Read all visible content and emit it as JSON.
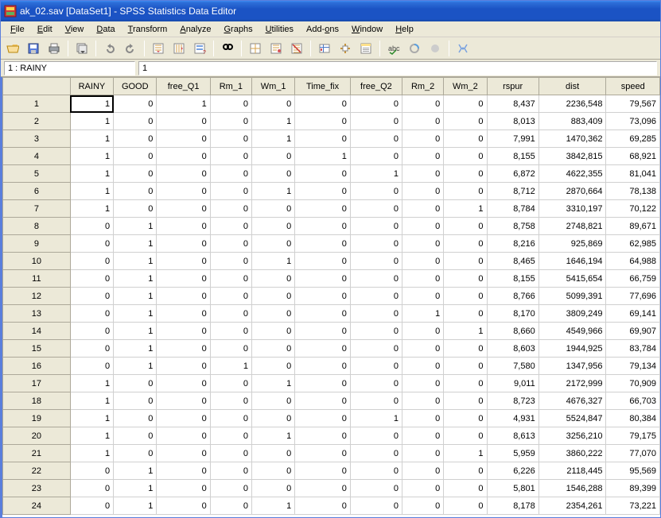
{
  "window": {
    "title": "ak_02.sav [DataSet1] - SPSS Statistics Data Editor"
  },
  "menu": {
    "file": "File",
    "edit": "Edit",
    "view": "View",
    "data": "Data",
    "transform": "Transform",
    "analyze": "Analyze",
    "graphs": "Graphs",
    "utilities": "Utilities",
    "addons": "Add-ons",
    "window": "Window",
    "help": "Help"
  },
  "subbar": {
    "label": "1 : RAINY",
    "value": "1"
  },
  "columns": [
    "RAINY",
    "GOOD",
    "free_Q1",
    "Rm_1",
    "Wm_1",
    "Time_fix",
    "free_Q2",
    "Rm_2",
    "Wm_2",
    "rspur",
    "dist",
    "speed"
  ],
  "rows": [
    [
      1,
      0,
      1,
      0,
      0,
      0,
      0,
      0,
      0,
      "8,437",
      "2236,548",
      "79,567"
    ],
    [
      1,
      0,
      0,
      0,
      1,
      0,
      0,
      0,
      0,
      "8,013",
      "883,409",
      "73,096"
    ],
    [
      1,
      0,
      0,
      0,
      1,
      0,
      0,
      0,
      0,
      "7,991",
      "1470,362",
      "69,285"
    ],
    [
      1,
      0,
      0,
      0,
      0,
      1,
      0,
      0,
      0,
      "8,155",
      "3842,815",
      "68,921"
    ],
    [
      1,
      0,
      0,
      0,
      0,
      0,
      1,
      0,
      0,
      "6,872",
      "4622,355",
      "81,041"
    ],
    [
      1,
      0,
      0,
      0,
      1,
      0,
      0,
      0,
      0,
      "8,712",
      "2870,664",
      "78,138"
    ],
    [
      1,
      0,
      0,
      0,
      0,
      0,
      0,
      0,
      1,
      "8,784",
      "3310,197",
      "70,122"
    ],
    [
      0,
      1,
      0,
      0,
      0,
      0,
      0,
      0,
      0,
      "8,758",
      "2748,821",
      "89,671"
    ],
    [
      0,
      1,
      0,
      0,
      0,
      0,
      0,
      0,
      0,
      "8,216",
      "925,869",
      "62,985"
    ],
    [
      0,
      1,
      0,
      0,
      1,
      0,
      0,
      0,
      0,
      "8,465",
      "1646,194",
      "64,988"
    ],
    [
      0,
      1,
      0,
      0,
      0,
      0,
      0,
      0,
      0,
      "8,155",
      "5415,654",
      "66,759"
    ],
    [
      0,
      1,
      0,
      0,
      0,
      0,
      0,
      0,
      0,
      "8,766",
      "5099,391",
      "77,696"
    ],
    [
      0,
      1,
      0,
      0,
      0,
      0,
      0,
      1,
      0,
      "8,170",
      "3809,249",
      "69,141"
    ],
    [
      0,
      1,
      0,
      0,
      0,
      0,
      0,
      0,
      1,
      "8,660",
      "4549,966",
      "69,907"
    ],
    [
      0,
      1,
      0,
      0,
      0,
      0,
      0,
      0,
      0,
      "8,603",
      "1944,925",
      "83,784"
    ],
    [
      0,
      1,
      0,
      1,
      0,
      0,
      0,
      0,
      0,
      "7,580",
      "1347,956",
      "79,134"
    ],
    [
      1,
      0,
      0,
      0,
      1,
      0,
      0,
      0,
      0,
      "9,011",
      "2172,999",
      "70,909"
    ],
    [
      1,
      0,
      0,
      0,
      0,
      0,
      0,
      0,
      0,
      "8,723",
      "4676,327",
      "66,703"
    ],
    [
      1,
      0,
      0,
      0,
      0,
      0,
      1,
      0,
      0,
      "4,931",
      "5524,847",
      "80,384"
    ],
    [
      1,
      0,
      0,
      0,
      1,
      0,
      0,
      0,
      0,
      "8,613",
      "3256,210",
      "79,175"
    ],
    [
      1,
      0,
      0,
      0,
      0,
      0,
      0,
      0,
      1,
      "5,959",
      "3860,222",
      "77,070"
    ],
    [
      0,
      1,
      0,
      0,
      0,
      0,
      0,
      0,
      0,
      "6,226",
      "2118,445",
      "95,569"
    ],
    [
      0,
      1,
      0,
      0,
      0,
      0,
      0,
      0,
      0,
      "5,801",
      "1546,288",
      "89,399"
    ],
    [
      0,
      1,
      0,
      0,
      1,
      0,
      0,
      0,
      0,
      "8,178",
      "2354,261",
      "73,221"
    ]
  ],
  "selected": {
    "row": 0,
    "col": 0
  }
}
